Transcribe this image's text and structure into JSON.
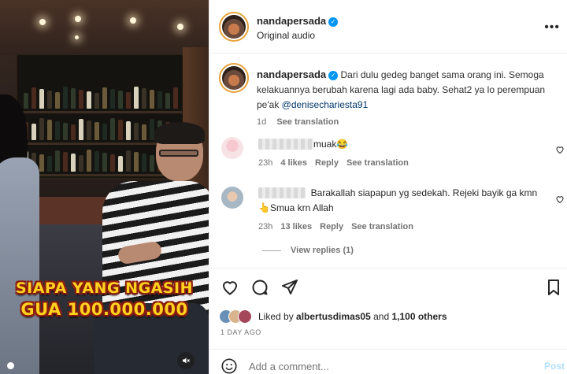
{
  "video": {
    "caption_line1": "SIAPA YANG NGASIH",
    "caption_line2": "GUA 100.000.000",
    "mute_icon": "speaker-muted-icon"
  },
  "header": {
    "username": "nandapersada",
    "verified": true,
    "subtitle": "Original audio",
    "more_icon": "more-horizontal-icon"
  },
  "caption": {
    "username": "nandapersada",
    "text": "Dari dulu gedeg banget sama orang ini. Semoga kelakuannya berubah karena lagi ada baby. Sehat2 ya lo perempuan pe'ak",
    "mention": "@denisechariesta91",
    "time": "1d",
    "see_translation": "See translation"
  },
  "comments": [
    {
      "text": "muak😂",
      "time": "23h",
      "likes": "4 likes",
      "reply": "Reply",
      "see_translation": "See translation"
    },
    {
      "text": "Barakallah siapapun yg sedekah. Rejeki bayik ga kmn👆Smua krn Allah",
      "time": "23h",
      "likes": "13 likes",
      "reply": "Reply",
      "see_translation": "See translation",
      "view_replies": "View replies (1)"
    }
  ],
  "actions": {
    "icons": [
      "heart-icon",
      "comment-icon",
      "share-icon",
      "bookmark-icon"
    ],
    "liked_by_prefix": "Liked by",
    "liked_by_user": "albertusdimas05",
    "liked_by_and": "and",
    "liked_by_others": "1,100 others",
    "date": "1 DAY AGO"
  },
  "add_comment": {
    "placeholder": "Add a comment...",
    "post_label": "Post"
  },
  "colors": {
    "accent": "#0095f6",
    "mention": "#00376b",
    "muted": "#737373",
    "caption_yellow": "#ffd21f"
  }
}
